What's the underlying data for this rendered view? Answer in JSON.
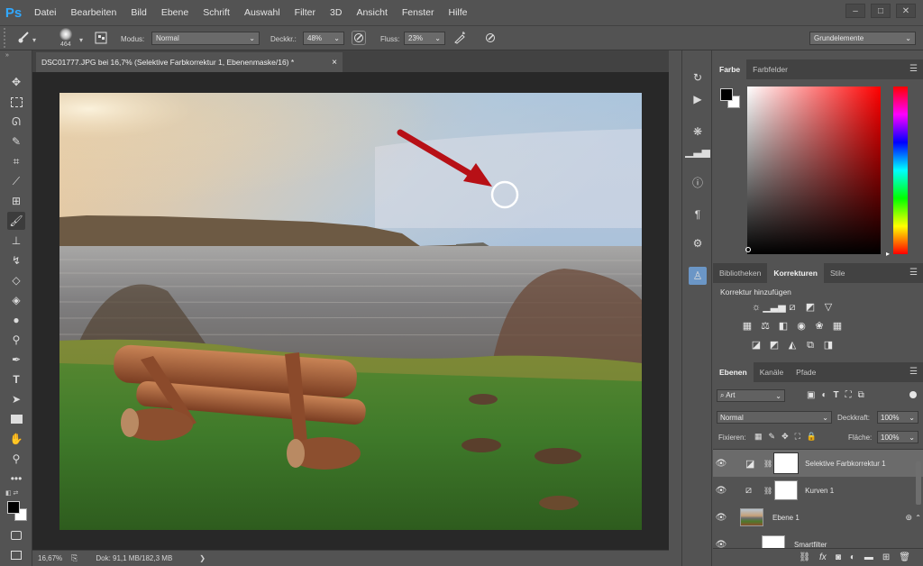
{
  "app": {
    "logo": "Ps"
  },
  "menu": [
    "Datei",
    "Bearbeiten",
    "Bild",
    "Ebene",
    "Schrift",
    "Auswahl",
    "Filter",
    "3D",
    "Ansicht",
    "Fenster",
    "Hilfe"
  ],
  "window_controls": {
    "minimize": "–",
    "restore": "□",
    "close": "✕"
  },
  "options": {
    "brush_size": "464",
    "mode_label": "Modus:",
    "mode_value": "Normal",
    "opacity_label": "Deckkr.:",
    "opacity_value": "48%",
    "flow_label": "Fluss:",
    "flow_value": "23%",
    "workspace": "Grundelemente"
  },
  "document": {
    "tab_title": "DSC01777.JPG bei 16,7% (Selektive Farbkorrektur 1, Ebenenmaske/16) *",
    "tab_close": "×",
    "zoom": "16,67%",
    "doc_info": "Dok: 91,1 MB/182,3 MB",
    "status_arrow": "❯"
  },
  "color_panel": {
    "tabs": [
      "Farbe",
      "Farbfelder"
    ],
    "hue_color": "#ff0000"
  },
  "adjustments_panel": {
    "tabs": [
      "Bibliotheken",
      "Korrekturen",
      "Stile"
    ],
    "heading": "Korrektur hinzufügen"
  },
  "layers_panel": {
    "tabs": [
      "Ebenen",
      "Kanäle",
      "Pfade"
    ],
    "filter_kind": "Art",
    "blend_mode": "Normal",
    "opacity_label": "Deckkraft:",
    "opacity_value": "100%",
    "lock_label": "Fixieren:",
    "fill_label": "Fläche:",
    "fill_value": "100%",
    "layers": [
      {
        "name": "Selektive Farbkorrektur 1",
        "selected": true
      },
      {
        "name": "Kurven 1",
        "selected": false
      },
      {
        "name": "Ebene 1",
        "selected": false
      },
      {
        "name": "Smartfilter",
        "selected": false
      }
    ]
  },
  "icons": {
    "toolbar": [
      "move-icon",
      "marquee-icon",
      "lasso-icon",
      "quick-select-icon",
      "crop-icon",
      "eyedropper-icon",
      "healing-icon",
      "brush-icon",
      "stamp-icon",
      "history-brush-icon",
      "eraser-icon",
      "bucket-icon",
      "blur-icon",
      "dodge-icon",
      "pen-icon",
      "type-icon",
      "path-select-icon",
      "rectangle-icon",
      "hand-icon",
      "zoom-icon",
      "more-icon"
    ]
  }
}
